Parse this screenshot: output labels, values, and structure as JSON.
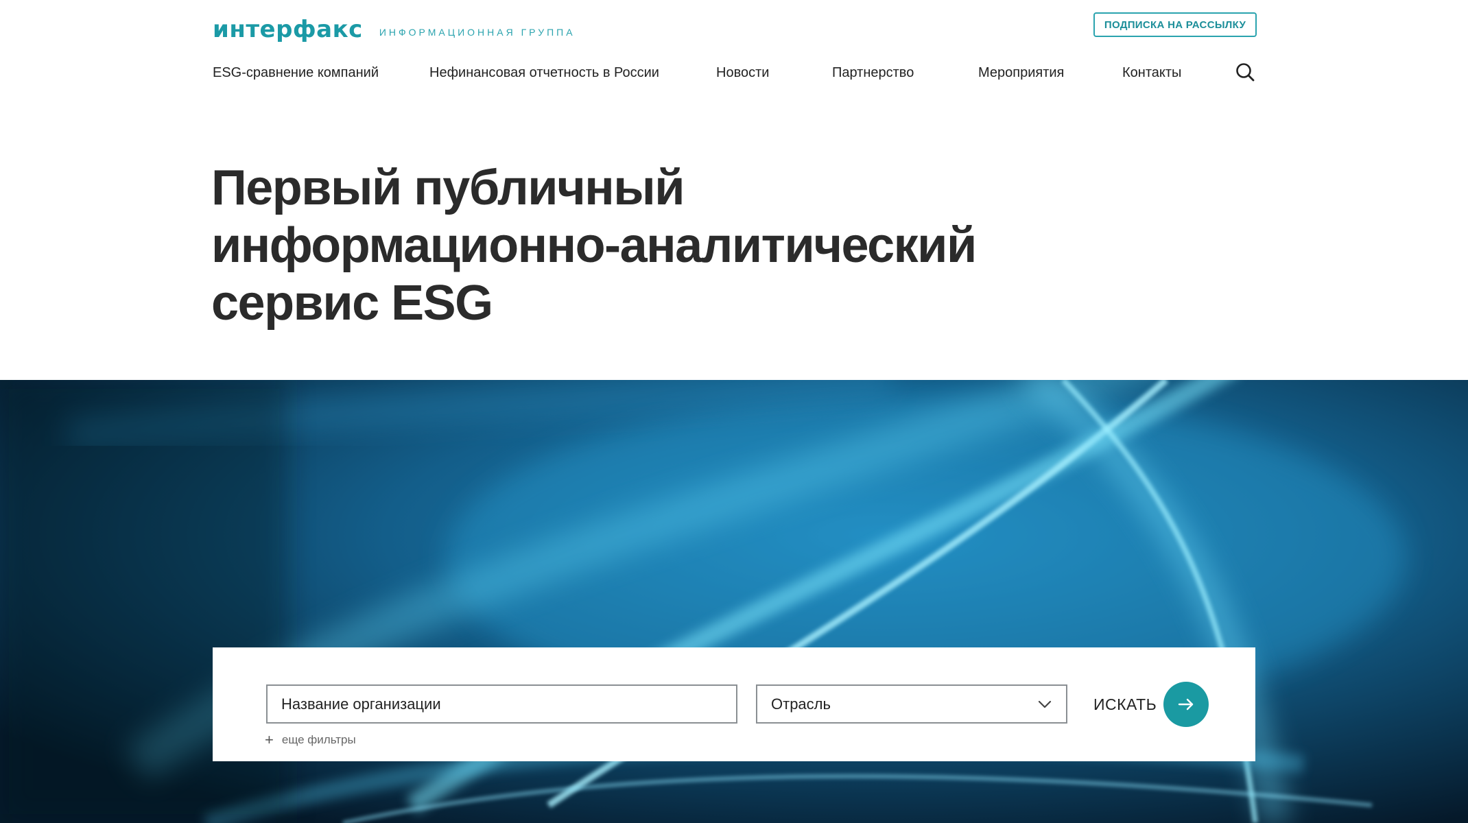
{
  "header": {
    "logo_text": "интерфакс",
    "logo_subtitle": "ИНФОРМАЦИОННАЯ ГРУППА",
    "subscribe_label": "ПОДПИСКА НА РАССЫЛКУ"
  },
  "nav": {
    "items": [
      {
        "label": "ESG-сравнение компаний"
      },
      {
        "label": "Нефинансовая отчетность в России"
      },
      {
        "label": "Новости"
      },
      {
        "label": "Партнерство"
      },
      {
        "label": "Мероприятия"
      },
      {
        "label": "Контакты"
      }
    ],
    "search_icon": "search-icon"
  },
  "hero": {
    "title_line1": "Первый публичный",
    "title_line2": "информационно-аналитический",
    "title_line3": "сервис ESG"
  },
  "search": {
    "org_placeholder": "Название организации",
    "industry_value": "Отрасль",
    "submit_label": "ИСКАТЬ",
    "more_filters_label": "еще фильтры"
  },
  "colors": {
    "accent": "#1a9aa2",
    "logo": "#1b9aa6",
    "text": "#222222",
    "banner_dark": "#0a2c44",
    "banner_light": "#5fd8f5"
  }
}
